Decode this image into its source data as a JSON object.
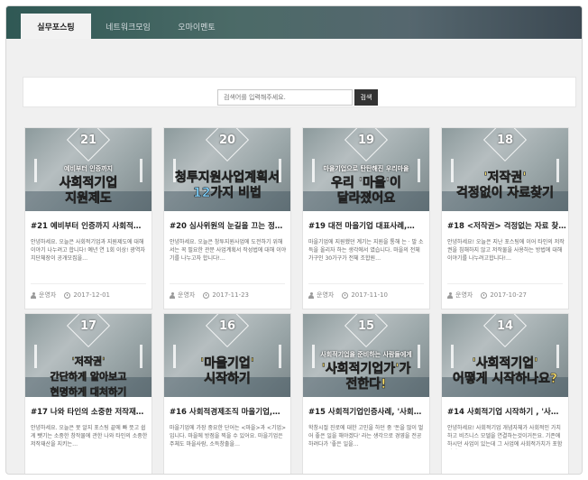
{
  "tabs": [
    {
      "label": "실무포스팅",
      "active": true
    },
    {
      "label": "네트워크모임",
      "active": false
    },
    {
      "label": "오마이멘토",
      "active": false
    }
  ],
  "search": {
    "placeholder": "검색어를 입력해주세요.",
    "button": "검색"
  },
  "posts": [
    {
      "num": "21",
      "sub": "예비부터 인증까지",
      "main": "사회적기업\n지원제도",
      "main_color": "#ffffff",
      "title": "#21 예비부터 인증까지 사회적…",
      "excerpt": "안녕하세요. 오늘은 사회적기업과 지원제도에 대해 이야기 나누려고 합니다! 예년 연 1회 이상! 광역자치단체장이 공개모집을…",
      "author": "운영자",
      "date": "2017-12-01"
    },
    {
      "num": "20",
      "sub": "",
      "main": "청투지원사업계획서\n12가지 비법",
      "main_color": "#7fd3ff",
      "title": "#20 심사위원의 눈길을 끄는 정…",
      "excerpt": "안녕하세요. 오늘은 창투지원사업에 도전하기 위해서는 꼭 필요한 관문 사업계획서 작성법에 대해 이야기를 나누고자 합니다!…",
      "author": "운영자",
      "date": "2017-11-23"
    },
    {
      "num": "19",
      "sub": "마을기업으로 탄탄해진 우리마을",
      "main": "우리 '마을'이\n달라졌어요",
      "main_color": "#ffffff",
      "title": "#19 대전 마을기업 대표사례,…",
      "excerpt": "마을기업에 지원했던 계기는 지원을 통해 는 · 발 소득을 올리자 하는 생각에서 였습니다. 마을의 전체 가구인 30가구가 전체 조합원…",
      "author": "운영자",
      "date": "2017-11-10"
    },
    {
      "num": "18",
      "sub": "",
      "main": "'저작권'\n걱정없이 자료찾기",
      "main_color": "#ffe36a",
      "title": "#18 <저작권> 걱정없는 자료 찾…",
      "excerpt": "안녕하세요! 오늘은 지난 포스팅에 이어 타인의 저작권을 침해하지 않고 저작물을 사용하는 방법에 대해 이야기를 나누려고합니다!…",
      "author": "운영자",
      "date": "2017-10-27"
    },
    {
      "num": "17",
      "sub": "",
      "main": "'저작권'\n간단하게 알아보고\n현명하게 대처하기",
      "main_color": "#ffe36a",
      "title": "#17 나와 타인의 소중한 저작재…",
      "excerpt": "안녕하세요. 오늘은 못 알지 포스팅 끝에 빠 뜻고 쉽게 뺏기는 소중한 창작물에 관한 나와 타인의 소중한 저작재산을 지키는…",
      "author": "",
      "date": ""
    },
    {
      "num": "16",
      "sub": "",
      "main": "'마을기업'\n시작하기",
      "main_color": "#ffe36a",
      "title": "#16 사회적경제조직 마을기업,…",
      "excerpt": "마을기업에 가장 중요한 단어는 <마을>과 <기업> 입니다. 마을에 방점을 찍을 수 있어요. 마을기업은 주체도 마을사람, 소득창출을…",
      "author": "",
      "date": ""
    },
    {
      "num": "15",
      "sub": "사회적기업을 준비하는 사람들에게",
      "main": "'사회적기업가'가\n전한다!",
      "main_color": "#ffe36a",
      "title": "#15 사회적기업인증사례, '사회…",
      "excerpt": "학창시절 진로에 대한 고민을 하던 중 '돈을 많이 벌어 좋은 일을 해야겠다' 라는 생각으로 경영을 전공하려다가 '좋은 일을…",
      "author": "",
      "date": ""
    },
    {
      "num": "14",
      "sub": "",
      "main": "'사회적기업'\n어떻게 시작하나요?",
      "main_color": "#ffe36a",
      "title": "#14 사회적기업 시작하기 , '사…",
      "excerpt": "안녕하세요! 사회적기업 개념자체가 사회적인 가치하고 비즈니스 모델을 연결하는것이거든요. 기존에 하시던 사업이 있는데 그 사업에 사회적가치가 포함되어…",
      "author": "",
      "date": ""
    }
  ]
}
